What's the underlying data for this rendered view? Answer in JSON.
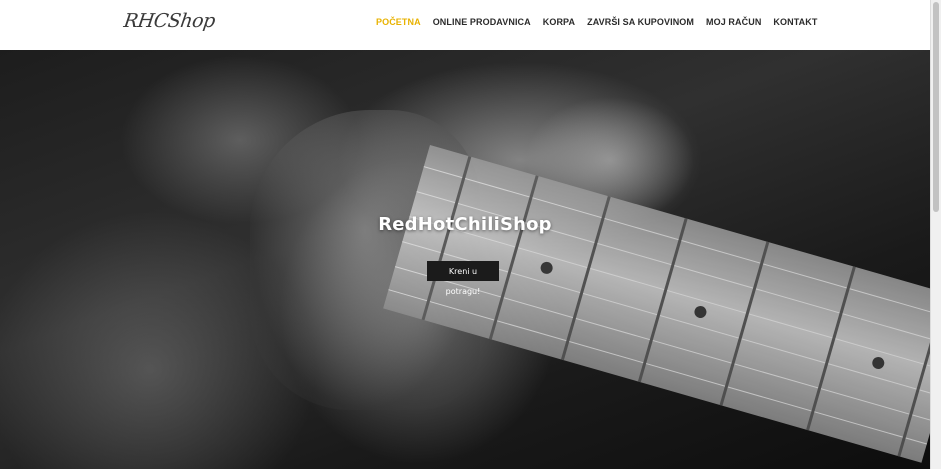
{
  "header": {
    "logo_text": "RHCShop",
    "nav": [
      {
        "label": "POČETNA",
        "active": true
      },
      {
        "label": "ONLINE PRODAVNICA",
        "active": false
      },
      {
        "label": "KORPA",
        "active": false
      },
      {
        "label": "ZAVRŠI SA KUPOVINOM",
        "active": false
      },
      {
        "label": "MOJ RAČUN",
        "active": false
      },
      {
        "label": "KONTAKT",
        "active": false
      }
    ]
  },
  "hero": {
    "title": "RedHotChiliShop",
    "button_label": "Kreni u potragu!"
  },
  "colors": {
    "accent": "#e8b200",
    "nav_text": "#2b2b2b",
    "button_bg": "#1b1b1b"
  }
}
